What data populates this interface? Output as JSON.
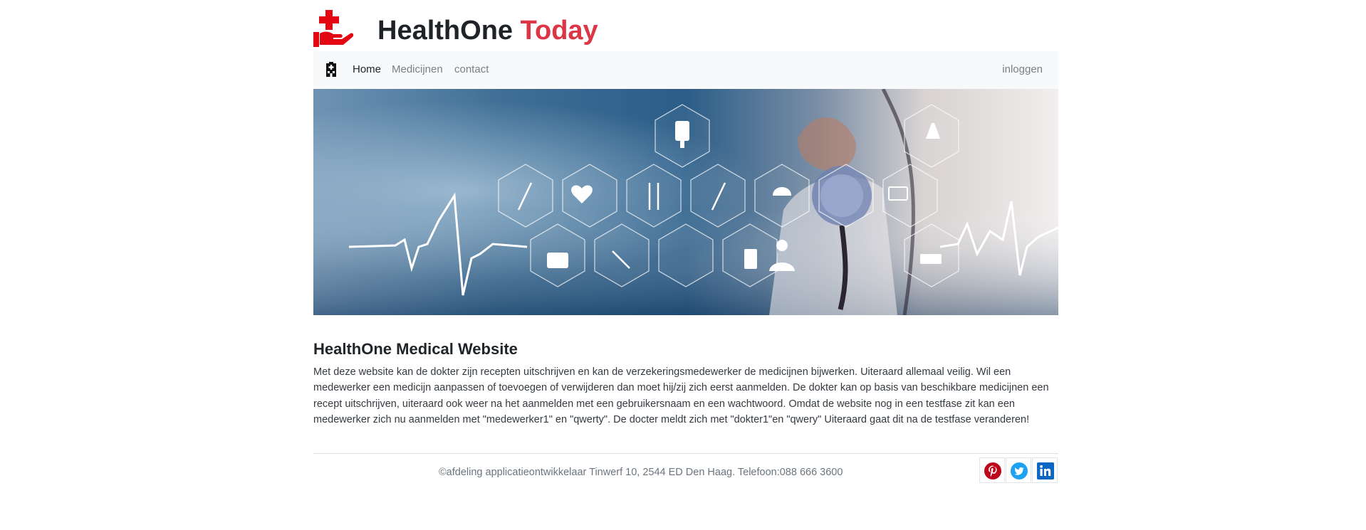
{
  "brand": {
    "title_part1": "HealthOne",
    "title_part2": "Today",
    "logo_icon": "hand-holding-medical-icon",
    "accent_color": "#dc3545"
  },
  "nav": {
    "home_icon": "hospital-icon",
    "items": [
      {
        "label": "Home",
        "active": true
      },
      {
        "label": "Medicijnen",
        "active": false
      },
      {
        "label": "contact",
        "active": false
      }
    ],
    "login_label": "inloggen"
  },
  "hero": {
    "image": "medical-banner-with-doctor-stethoscope-and-hexagon-icons"
  },
  "content": {
    "title": "HealthOne Medical Website",
    "text": "Met deze website kan de dokter zijn recepten uitschrijven en kan de verzekeringsmedewerker de medicijnen bijwerken. Uiteraard allemaal veilig. Wil een medewerker een medicijn aanpassen of toevoegen of verwijderen dan moet hij/zij zich eerst aanmelden. De dokter kan op basis van beschikbare medicijnen een recept uitschrijven, uiteraard ook weer na het aanmelden met een gebruikersnaam en een wachtwoord. Omdat de website nog in een testfase zit kan een medewerker zich nu aanmelden met \"medewerker1\" en \"qwerty\". De docter meldt zich met \"dokter1\"en \"qwery\" Uiteraard gaat dit na de testfase veranderen!"
  },
  "footer": {
    "text": "©afdeling applicatieontwikkelaar Tinwerf 10, 2544 ED Den Haag. Telefoon:088 666 3600",
    "social": [
      {
        "name": "pinterest-icon",
        "color": "#bd081c"
      },
      {
        "name": "twitter-icon",
        "color": "#1da1f2"
      },
      {
        "name": "linkedin-icon",
        "color": "#0a66c2"
      }
    ]
  }
}
